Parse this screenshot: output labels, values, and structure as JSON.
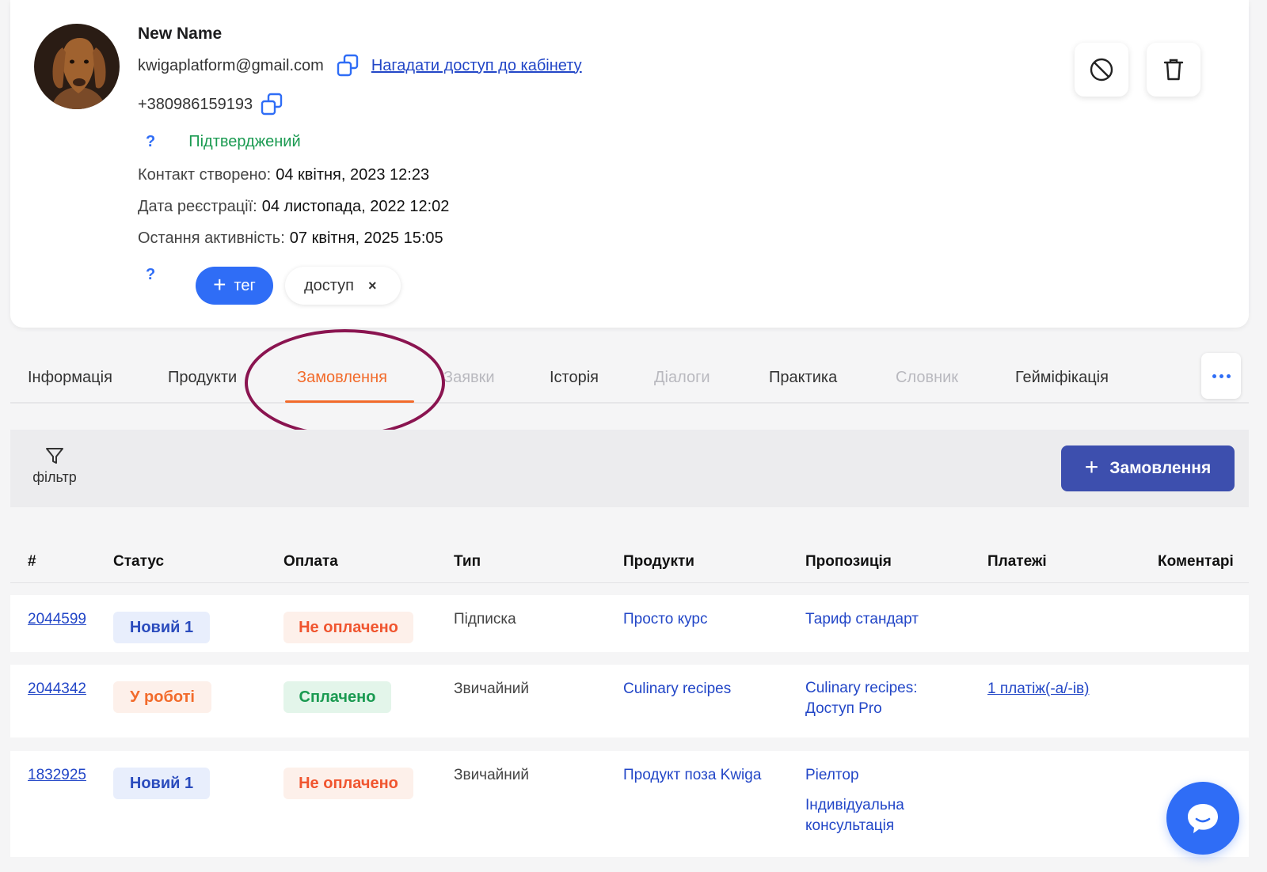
{
  "profile": {
    "name": "New Name",
    "email": "kwigaplatform@gmail.com",
    "remind_access_link": "Нагадати доступ до кабінету",
    "phone": "+380986159193",
    "help_mark": "?",
    "status": "Підтверджений",
    "created_label": "Контакт створено:",
    "created_value": "04 квітня, 2023 12:23",
    "registered_label": "Дата реєстрації:",
    "registered_value": "04 листопада, 2022 12:02",
    "last_active_label": "Остання активність:",
    "last_active_value": "07 квітня, 2025 15:05",
    "tag_button": "тег",
    "tag_button_plus": "+",
    "tags": [
      {
        "label": "доступ",
        "remove": "×"
      }
    ]
  },
  "tabs": [
    {
      "label": "Інформація",
      "state": "normal"
    },
    {
      "label": "Продукти",
      "state": "normal"
    },
    {
      "label": "Замовлення",
      "state": "active"
    },
    {
      "label": "Заявки",
      "state": "muted"
    },
    {
      "label": "Історія",
      "state": "normal"
    },
    {
      "label": "Діалоги",
      "state": "muted"
    },
    {
      "label": "Практика",
      "state": "normal"
    },
    {
      "label": "Словник",
      "state": "muted"
    },
    {
      "label": "Гейміфікація",
      "state": "normal"
    }
  ],
  "toolbar": {
    "filter_label": "фільтр",
    "add_order_plus": "+",
    "add_order_label": "Замовлення"
  },
  "table": {
    "headers": [
      "#",
      "Статус",
      "Оплата",
      "Тип",
      "Продукти",
      "Пропозиція",
      "Платежі",
      "Коментарі"
    ],
    "rows": [
      {
        "id": "2044599",
        "status": "Новий 1",
        "payment": "Не оплачено",
        "type": "Підписка",
        "product": "Просто курс",
        "offer": [
          "Тариф стандарт"
        ],
        "payments": ""
      },
      {
        "id": "2044342",
        "status": "У роботі",
        "payment": "Сплачено",
        "type": "Звичайний",
        "product": "Culinary recipes",
        "offer": [
          "Culinary recipes:",
          "Доступ Pro"
        ],
        "payments": "1 платіж(-а/-ів)"
      },
      {
        "id": "1832925",
        "status": "Новий 1",
        "payment": "Не оплачено",
        "type": "Звичайний",
        "product": "Продукт поза Kwiga",
        "offer": [
          "Ріелтор",
          "Індивідуальна",
          "консультація"
        ],
        "payments": ""
      }
    ]
  },
  "colors": {
    "accent_blue": "#2f6df6",
    "active_tab_orange": "#f26b2b",
    "confirmed_green": "#1a9a51",
    "add_order_button": "#3d4fae",
    "annotation_circle": "#8a1450"
  },
  "icons": [
    "copy-icon",
    "block-icon",
    "trash-icon",
    "filter-icon",
    "chat-icon",
    "more-dots-icon",
    "close-icon",
    "plus-icon"
  ]
}
